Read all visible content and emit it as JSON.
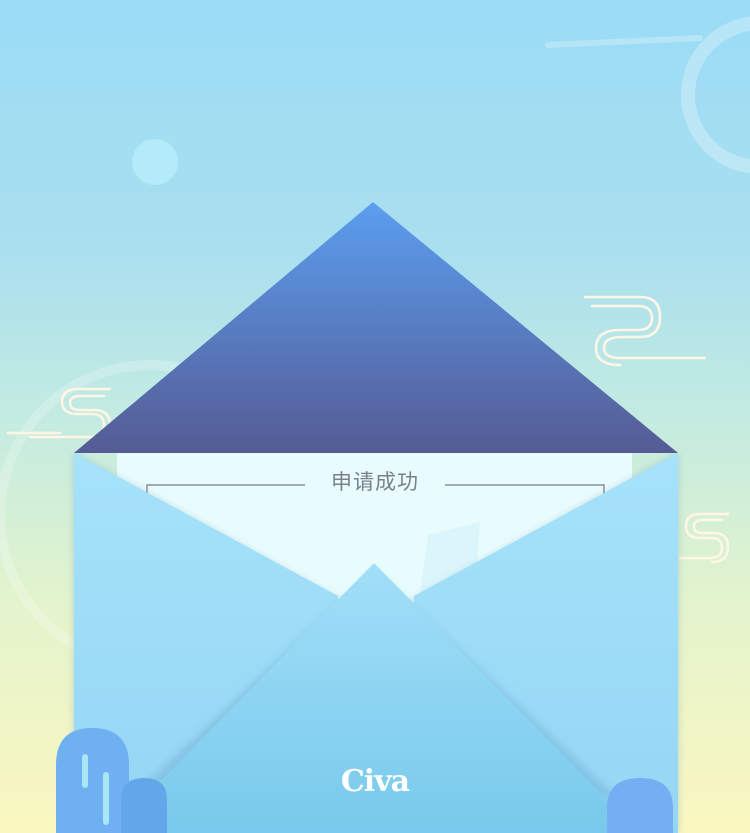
{
  "card": {
    "title": "申请成功"
  },
  "brand": {
    "logo_text": "Civa"
  },
  "colors": {
    "sky_top": "#9adcf6",
    "sky_bottom": "#fbf7c0",
    "flap_top": "#5a9ae8",
    "flap_bottom": "#545d98",
    "envelope": "#9ddcf7",
    "envelope_front": "#7ccbea",
    "paper": "#e8fcfd",
    "pillar": "#6fb0f2"
  }
}
